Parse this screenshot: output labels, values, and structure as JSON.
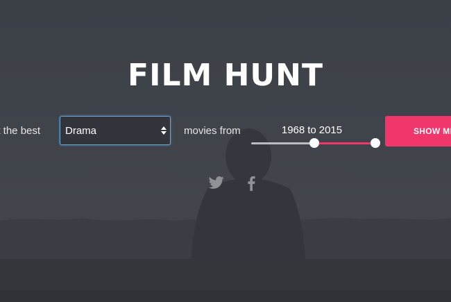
{
  "app": {
    "title": "FILM HUNT"
  },
  "search": {
    "lead_text": "nt the best",
    "genre_selected": "Drama",
    "middle_text": "movies from",
    "year_from": "1968",
    "range_separator": "to",
    "year_to": "2015",
    "year_from_fraction": 0.49,
    "year_to_fraction": 1.0,
    "submit_label": "SHOW ME"
  },
  "social": {
    "icons": [
      "twitter-icon",
      "facebook-icon"
    ]
  },
  "colors": {
    "accent": "#f0366a",
    "background": "#3c4047",
    "select_border": "#6aa8d8"
  }
}
